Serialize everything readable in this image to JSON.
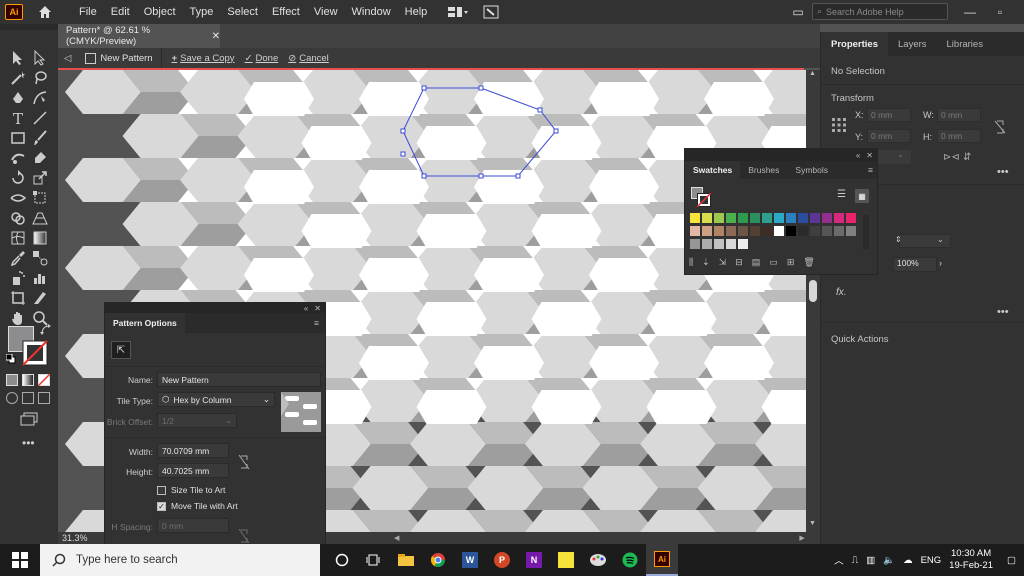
{
  "app": {
    "logo_text": "Ai",
    "menu": [
      "File",
      "Edit",
      "Object",
      "Type",
      "Select",
      "Effect",
      "View",
      "Window",
      "Help"
    ],
    "search_placeholder": "Search Adobe Help"
  },
  "document": {
    "tab_title": "Pattern* @ 62.61 % (CMYK/Preview)",
    "pattern_name": "New Pattern",
    "actions": {
      "save_copy": "Save a Copy",
      "done": "Done",
      "cancel": "Cancel"
    },
    "zoom": "31.3%"
  },
  "right_panel": {
    "tabs": [
      "Properties",
      "Layers",
      "Libraries"
    ],
    "no_selection": "No Selection",
    "transform_label": "Transform",
    "x_label": "X:",
    "y_label": "Y:",
    "w_label": "W:",
    "h_label": "H:",
    "zero_mm": "0 mm",
    "opacity": "100%",
    "fx_label": "fx.",
    "quick_actions": "Quick Actions"
  },
  "swatches_panel": {
    "tabs": [
      "Swatches",
      "Brushes",
      "Symbols"
    ],
    "colors": [
      "#f7e43a",
      "#d7e04c",
      "#9cc84d",
      "#4bb04e",
      "#2c9b4b",
      "#2b8f5e",
      "#30a08e",
      "#2ca9c8",
      "#2c7fc1",
      "#2b4d9e",
      "#5e3596",
      "#92308c",
      "#d5287e",
      "#e8236a",
      "#e2b8a4",
      "#cfa182",
      "#b28265",
      "#8d6a58",
      "#6c5545",
      "#543f32",
      "#3d2d25",
      "#ffffff",
      "#000000",
      "#2b2b2b",
      "#3f3f3f",
      "#555555",
      "#6b6b6b",
      "#808080",
      "#969696",
      "#acacac",
      "#c2c2c2",
      "#d8d8d8",
      "#eeeeee"
    ]
  },
  "pattern_options": {
    "title": "Pattern Options",
    "name_label": "Name:",
    "name_value": "New Pattern",
    "tile_type_label": "Tile Type:",
    "tile_type_value": "Hex by Column",
    "brick_offset_label": "Brick Offset:",
    "brick_offset_value": "1/2",
    "width_label": "Width:",
    "width_value": "70.0709 mm",
    "height_label": "Height:",
    "height_value": "40.7025 mm",
    "size_tile_label": "Size Tile to Art",
    "move_tile_label": "Move Tile with Art",
    "h_spacing_label": "H Spacing:",
    "h_spacing_value": "0 mm"
  },
  "taskbar": {
    "search_placeholder": "Type here to search",
    "language": "ENG",
    "time": "10:30 AM",
    "date": "19-Feb-21"
  },
  "colors": {
    "accent_red": "#e64f4f",
    "selection_blue": "#3a4bd6",
    "illustrator_orange": "#ff9a00"
  }
}
